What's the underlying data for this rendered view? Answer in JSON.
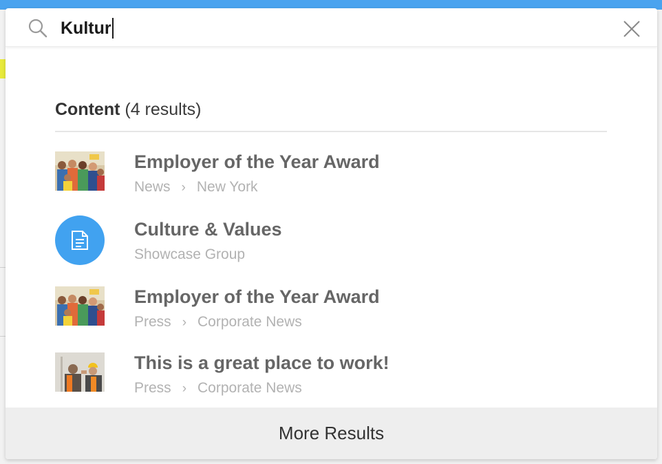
{
  "search": {
    "query": "Kultur",
    "placeholder": ""
  },
  "content_section": {
    "heading": "Content",
    "count_text": "(4 results)"
  },
  "results": [
    {
      "title": "Employer of the Year Award",
      "meta": [
        "News",
        "New York"
      ],
      "icon": "group-photo-thumbnail"
    },
    {
      "title": "Culture & Values",
      "meta": [
        "Showcase Group"
      ],
      "icon": "document-icon"
    },
    {
      "title": "Employer of the Year Award",
      "meta": [
        "Press",
        "Corporate News"
      ],
      "icon": "group-photo-thumbnail"
    },
    {
      "title": "This is a great place to work!",
      "meta": [
        "Press",
        "Corporate News"
      ],
      "icon": "workers-photo-thumbnail"
    }
  ],
  "breadcrumb_separator": "›",
  "more_results_label": "More Results",
  "colors": {
    "accent": "#41a2f0",
    "topbar": "#4aa3ef",
    "title_text": "#666666",
    "meta_text": "#b2b2b2"
  }
}
